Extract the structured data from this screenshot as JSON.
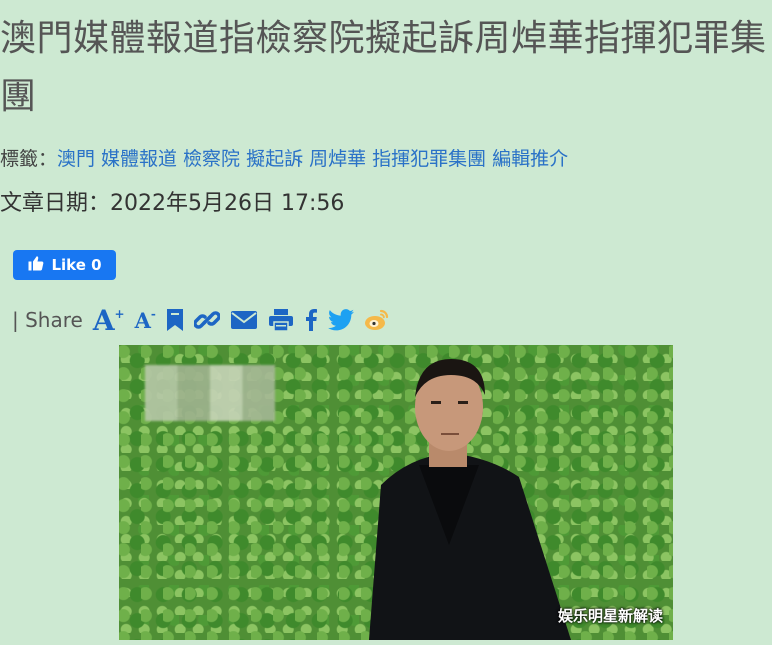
{
  "article": {
    "title": "澳門媒體報道指檢察院擬起訴周焯華指揮犯罪集團",
    "tags_label": "標籤：",
    "tags": [
      "澳門",
      "媒體報道",
      "檢察院",
      "擬起訴",
      "周焯華",
      "指揮犯罪集團",
      "編輯推介"
    ],
    "date_label": "文章日期：",
    "date_value": "2022年5月26日 17:56"
  },
  "social": {
    "like_label": "Like 0",
    "share_label": "| Share",
    "icons": [
      "font-increase-icon",
      "font-decrease-icon",
      "bookmark-icon",
      "link-icon",
      "email-icon",
      "print-icon",
      "facebook-icon",
      "twitter-icon",
      "weibo-icon"
    ],
    "accent": "#1d66c4",
    "facebook_blue": "#1877f2"
  },
  "image": {
    "watermark": "娱乐明星新解读"
  }
}
